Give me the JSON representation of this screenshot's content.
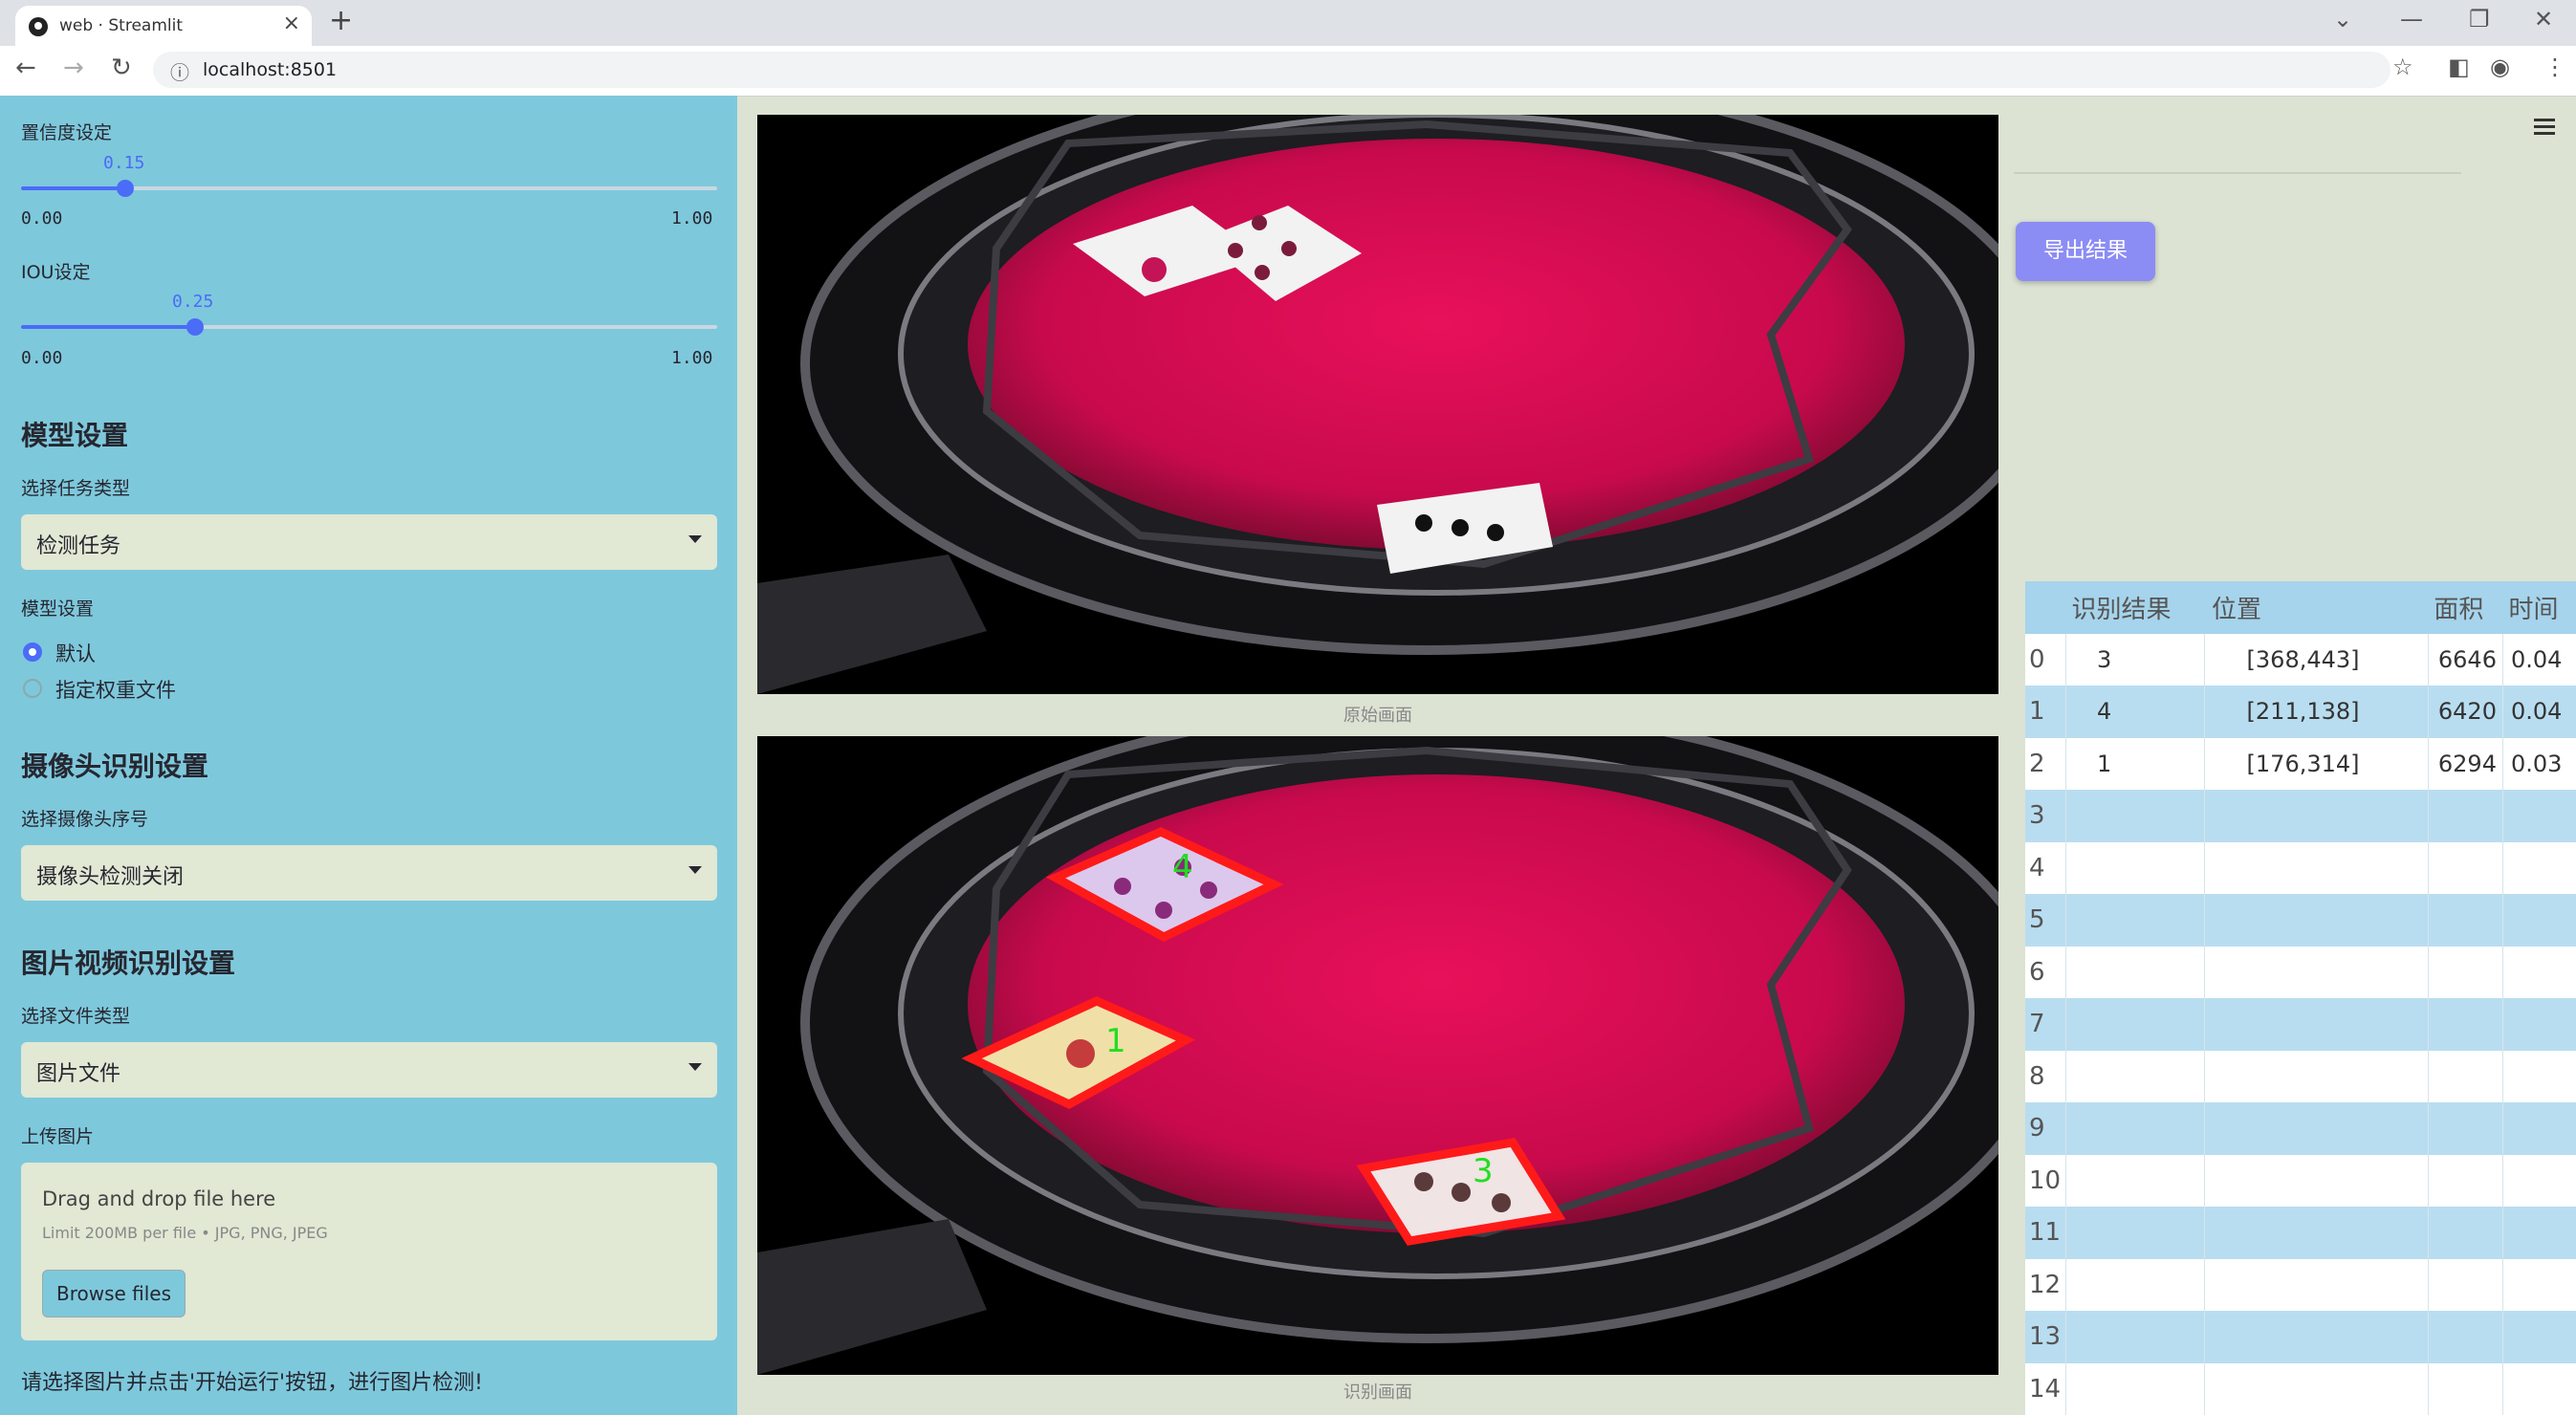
{
  "browser": {
    "tab_title": "web · Streamlit",
    "url": "localhost:8501"
  },
  "sidebar": {
    "confidence": {
      "label": "置信度设定",
      "value": "0.15",
      "min": "0.00",
      "max": "1.00",
      "fraction": 0.15
    },
    "iou": {
      "label": "IOU设定",
      "value": "0.25",
      "min": "0.00",
      "max": "1.00",
      "fraction": 0.25
    },
    "model_settings": {
      "header": "模型设置",
      "task_label": "选择任务类型",
      "task_value": "检测任务",
      "model_label": "模型设置",
      "options": [
        "默认",
        "指定权重文件"
      ],
      "selected_index": 0
    },
    "camera": {
      "header": "摄像头识别设置",
      "label": "选择摄像头序号",
      "value": "摄像头检测关闭"
    },
    "media": {
      "header": "图片视频识别设置",
      "file_type_label": "选择文件类型",
      "file_type_value": "图片文件",
      "upload_label": "上传图片",
      "drop_text": "Drag and drop file here",
      "limit_text": "Limit 200MB per file • JPG, PNG, JPEG",
      "browse_label": "Browse files"
    },
    "hint": "请选择图片并点击'开始运行'按钮，进行图片检测!"
  },
  "main": {
    "original_caption": "原始画面",
    "result_caption": "识别画面",
    "detections": [
      {
        "label": "4",
        "color": "#ff1a1a"
      },
      {
        "label": "1",
        "color": "#ff1a1a"
      },
      {
        "label": "3",
        "color": "#ff1a1a"
      }
    ],
    "label_color": "#22dd22"
  },
  "right": {
    "export_label": "导出结果",
    "table": {
      "columns": [
        "",
        "识别结果",
        "位置",
        "面积",
        "时间"
      ],
      "rows": [
        [
          "0",
          "3",
          "[368,443]",
          "6646",
          "0.04"
        ],
        [
          "1",
          "4",
          "[211,138]",
          "6420",
          "0.04"
        ],
        [
          "2",
          "1",
          "[176,314]",
          "6294",
          "0.03"
        ],
        [
          "3",
          "",
          "",
          "",
          ""
        ],
        [
          "4",
          "",
          "",
          "",
          ""
        ],
        [
          "5",
          "",
          "",
          "",
          ""
        ],
        [
          "6",
          "",
          "",
          "",
          ""
        ],
        [
          "7",
          "",
          "",
          "",
          ""
        ],
        [
          "8",
          "",
          "",
          "",
          ""
        ],
        [
          "9",
          "",
          "",
          "",
          ""
        ],
        [
          "10",
          "",
          "",
          "",
          ""
        ],
        [
          "11",
          "",
          "",
          "",
          ""
        ],
        [
          "12",
          "",
          "",
          "",
          ""
        ],
        [
          "13",
          "",
          "",
          "",
          ""
        ],
        [
          "14",
          "",
          "",
          "",
          ""
        ]
      ]
    }
  }
}
